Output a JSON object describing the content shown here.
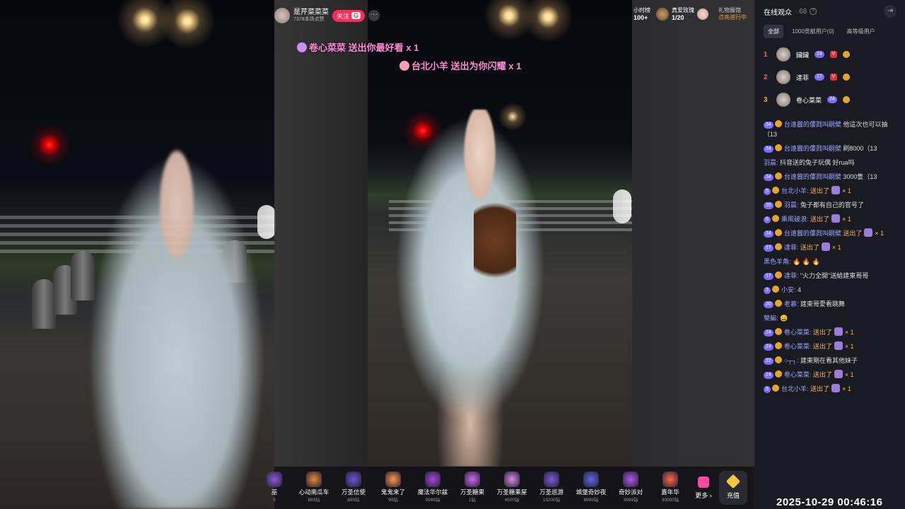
{
  "host": {
    "name": "是芹菜菜菜",
    "sub": "7378本场点赞",
    "follow_label": "关注",
    "follow_badge": "G",
    "more": "···"
  },
  "gift_messages": [
    {
      "text": "卷心菜菜 送出你最好看 x 1"
    },
    {
      "text": "台北小羊 送出为你闪耀 x 1"
    }
  ],
  "top_stats": {
    "hour_rank_label": "小时榜",
    "hour_rank_value": "100+",
    "rose_label": "真爱玫瑰",
    "rose_value": "1/20",
    "gift_label": "礼物展馆",
    "gift_status": "点亮进行中"
  },
  "gift_bar": {
    "items": [
      {
        "name": "巫",
        "price": "5",
        "color": "#8a5cd6"
      },
      {
        "name": "心动南瓜车",
        "price": "899钻",
        "color": "#e68a2e"
      },
      {
        "name": "万圣信使",
        "price": "699钻",
        "color": "#6a56c8"
      },
      {
        "name": "鬼鬼来了",
        "price": "99钻",
        "color": "#ff9a3c"
      },
      {
        "name": "魔法华尔兹",
        "price": "9999钻",
        "color": "#a04ad0"
      },
      {
        "name": "万圣糖果",
        "price": "1钻",
        "color": "#c86ae8"
      },
      {
        "name": "万圣糖果屋",
        "price": "4500钻",
        "color": "#d88ae0"
      },
      {
        "name": "万圣巡游",
        "price": "15200钻",
        "color": "#7a5ad8"
      },
      {
        "name": "城堡奇妙夜",
        "price": "8999钻",
        "color": "#5a6ae0"
      },
      {
        "name": "奇妙派对",
        "price": "3999钻",
        "color": "#b45ae8"
      },
      {
        "name": "嘉年华",
        "price": "30000钻",
        "color": "#ff6a3c"
      }
    ],
    "more_label": "更多",
    "recharge_label": "充值"
  },
  "panel": {
    "title": "在线观众",
    "count": "· 68",
    "tabs": [
      "全部",
      "1000贡献用户(0)",
      "高等级用户"
    ],
    "ranks": [
      {
        "num": "1",
        "name": "鑶鑶",
        "level": "24"
      },
      {
        "num": "2",
        "name": "達菲",
        "level": "17"
      },
      {
        "num": "3",
        "name": "卷心菜菜",
        "level": "24"
      }
    ],
    "chat": [
      {
        "level": "34",
        "user": "台遠囂的僂戮叫嗣檗",
        "text": "他這次也可以抽（13"
      },
      {
        "level": "34",
        "user": "台遠囂的僂戮叫嗣檗",
        "text": "刷8000（13"
      },
      {
        "level": "",
        "user": "羽晨:",
        "text": "抖音送的兔子玩偶 好rua吗"
      },
      {
        "level": "34",
        "user": "台遠囂的僂戮叫嗣檗",
        "text": "3000隻（13"
      },
      {
        "level": "5",
        "user": "台北小羊:",
        "text": "送出了",
        "gift": "× 1"
      },
      {
        "level": "35",
        "user": "羽晨:",
        "text": "兔子都有自己的官号了"
      },
      {
        "level": "6",
        "user": "乘風破浪:",
        "text": "送出了",
        "gift": "× 1"
      },
      {
        "level": "34",
        "user": "台遠囂的僂戮叫嗣檗",
        "text": "送出了",
        "gift": "× 1"
      },
      {
        "level": "17",
        "user": "達菲:",
        "text": "送出了",
        "gift": "× 1"
      },
      {
        "level": "",
        "user": "黑色羊角:",
        "text": "🔥 🔥 🔥"
      },
      {
        "level": "17",
        "user": "達菲:",
        "text": "\"火力全開\"送給建東哥哥"
      },
      {
        "level": "3",
        "user": "小安:",
        "text": "4"
      },
      {
        "level": "20",
        "user": "老慕:",
        "text": "建東哥愛看跳舞"
      },
      {
        "level": "",
        "user": "榮編:",
        "text": "😄"
      },
      {
        "level": "24",
        "user": "卷心菜菜:",
        "text": "送出了",
        "gift": "× 1"
      },
      {
        "level": "24",
        "user": "卷心菜菜:",
        "text": "送出了",
        "gift": "× 1"
      },
      {
        "level": "22",
        "user": "○┬┐:",
        "text": "建東剛在看其他妹子"
      },
      {
        "level": "24",
        "user": "卷心菜菜:",
        "text": "送出了",
        "gift": "× 1"
      },
      {
        "level": "5",
        "user": "台北小羊:",
        "text": "送出了",
        "gift": "× 1"
      }
    ]
  },
  "timestamp": "2025-10-29 00:46:16"
}
